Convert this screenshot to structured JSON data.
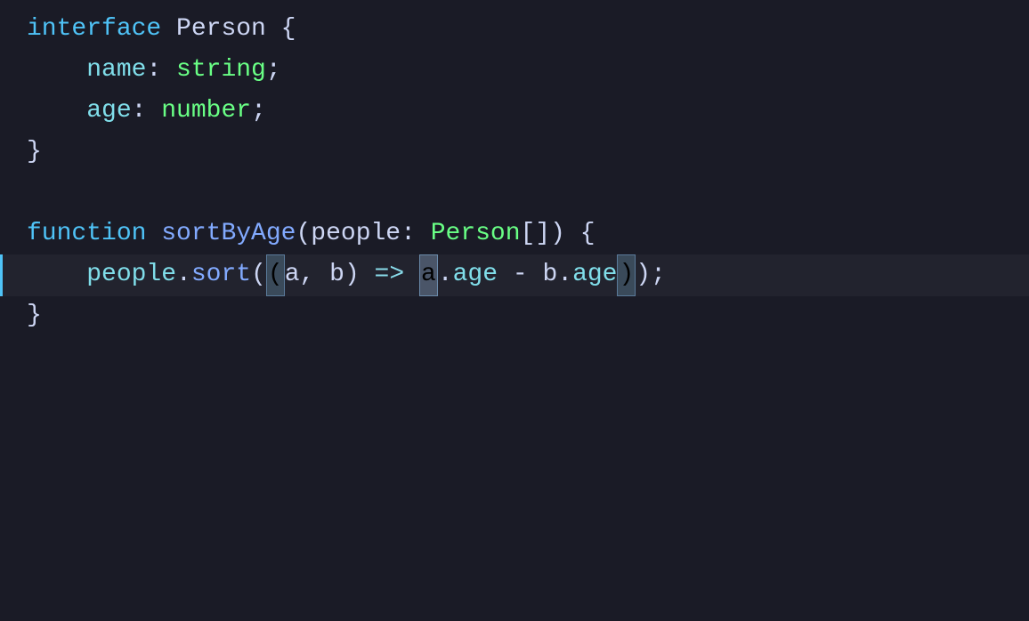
{
  "editor": {
    "background": "#1a1b26",
    "lines": [
      {
        "id": 1,
        "active": false,
        "tokens": [
          {
            "text": "interface",
            "class": "kw-blue"
          },
          {
            "text": " Person ",
            "class": "text-white"
          },
          {
            "text": "{",
            "class": "text-white"
          }
        ]
      },
      {
        "id": 2,
        "active": false,
        "tokens": [
          {
            "text": "    name",
            "class": "prop-cyan"
          },
          {
            "text": ": ",
            "class": "text-white"
          },
          {
            "text": "string",
            "class": "type-green"
          },
          {
            "text": ";",
            "class": "text-white"
          }
        ]
      },
      {
        "id": 3,
        "active": false,
        "tokens": [
          {
            "text": "    age",
            "class": "prop-cyan"
          },
          {
            "text": ": ",
            "class": "text-white"
          },
          {
            "text": "number",
            "class": "type-green"
          },
          {
            "text": ";",
            "class": "text-white"
          }
        ]
      },
      {
        "id": 4,
        "active": false,
        "tokens": [
          {
            "text": "}",
            "class": "text-white"
          }
        ]
      },
      {
        "id": 5,
        "active": false,
        "tokens": []
      },
      {
        "id": 6,
        "active": false,
        "tokens": [
          {
            "text": "function",
            "class": "kw-blue"
          },
          {
            "text": " sortByAge",
            "class": "fn-name"
          },
          {
            "text": "(",
            "class": "text-white"
          },
          {
            "text": "people",
            "class": "param"
          },
          {
            "text": ": ",
            "class": "text-white"
          },
          {
            "text": "Person",
            "class": "type-green"
          },
          {
            "text": "[]",
            "class": "text-white"
          },
          {
            "text": ") {",
            "class": "text-white"
          }
        ]
      },
      {
        "id": 7,
        "active": true,
        "tokens": "sort-line"
      },
      {
        "id": 8,
        "active": false,
        "tokens": [
          {
            "text": "}",
            "class": "text-white"
          }
        ]
      }
    ]
  }
}
